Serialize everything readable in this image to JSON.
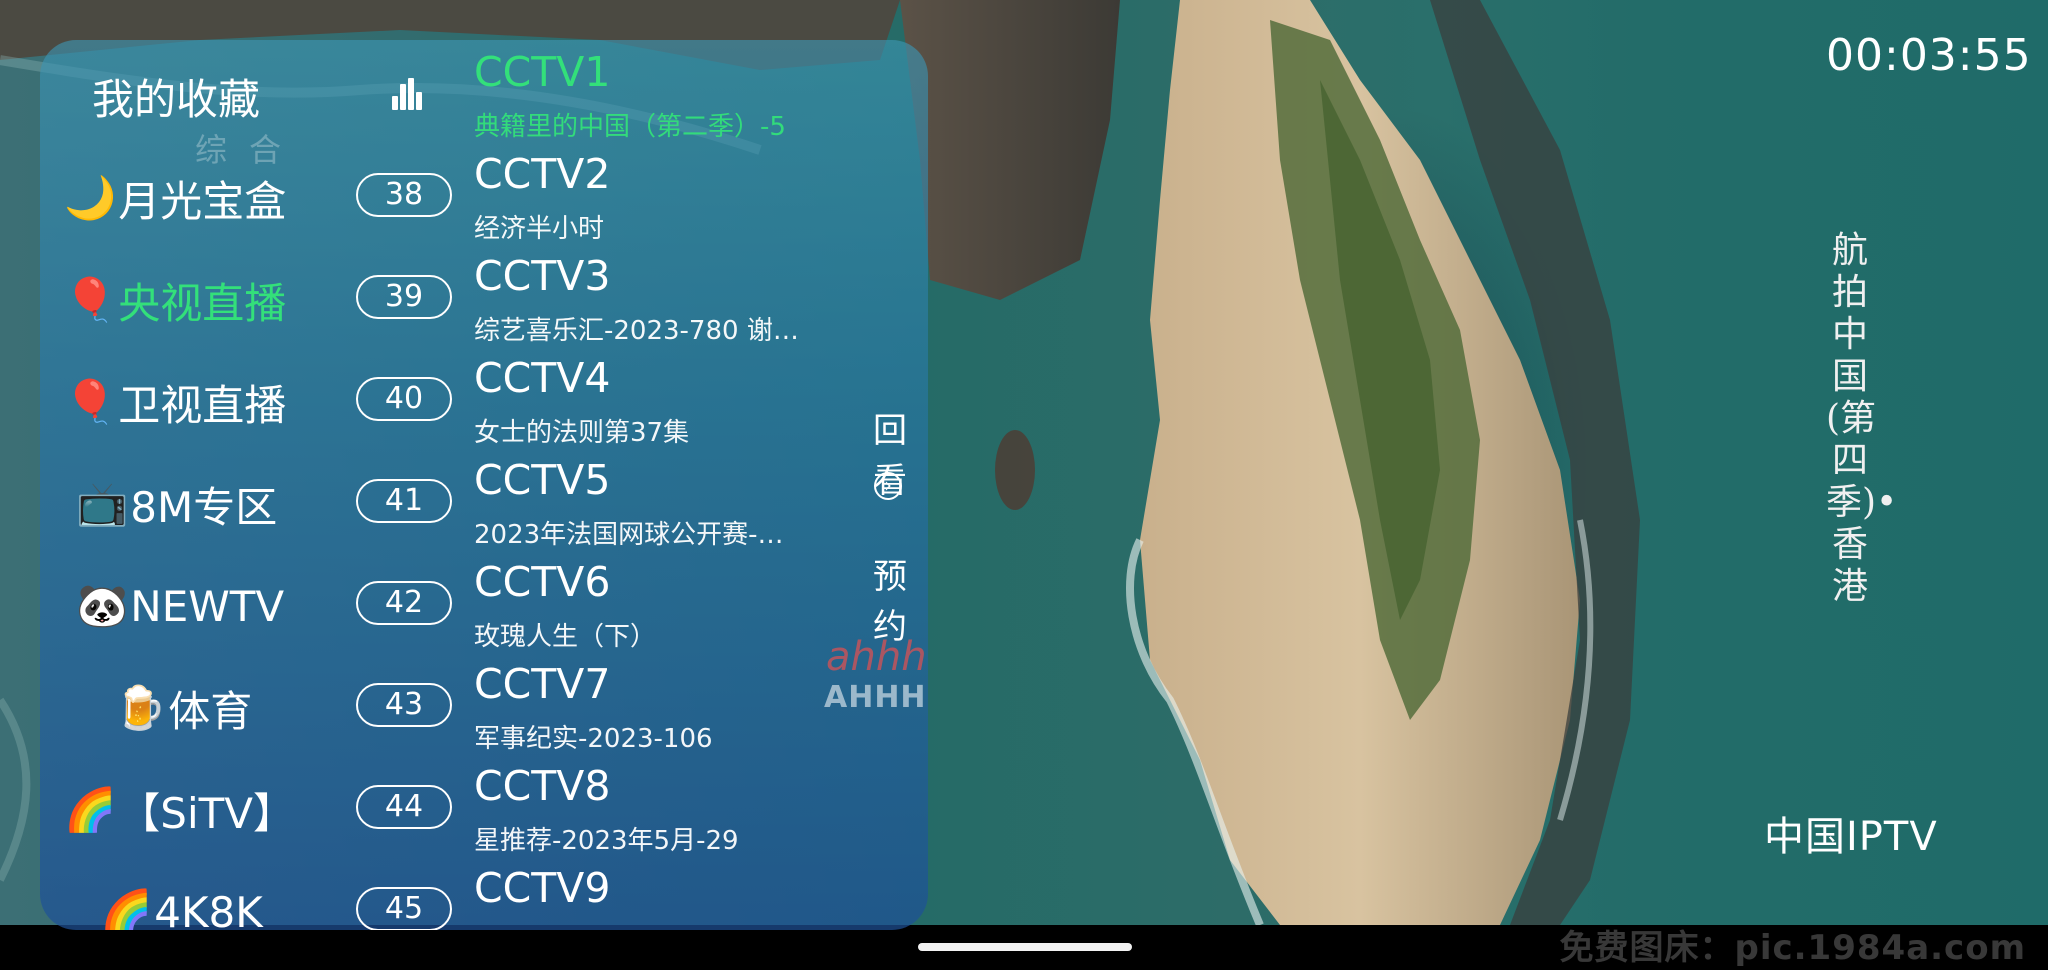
{
  "player": {
    "clock": "00:03:55",
    "program_title": "航拍中国(第四季)•香港",
    "channel_logo": "中国IPTV",
    "watermark": "免费图床：pic.1984a.com",
    "site_watermark": "AHHHHFS.COM",
    "site_watermark_logo": "ahhhhfs"
  },
  "categories": {
    "header": "我的收藏",
    "header_faint": "综合",
    "header_icon": "equalizer-icon",
    "items": [
      {
        "emoji": "🌙",
        "label": "月光宝盒",
        "active": false
      },
      {
        "emoji": "🎈",
        "label": "央视直播",
        "active": true
      },
      {
        "emoji": "🎈",
        "label": "卫视直播",
        "active": false
      },
      {
        "emoji": "📺",
        "label": "8M专区",
        "active": false
      },
      {
        "emoji": "🐼",
        "label": "NEWTV",
        "active": false
      },
      {
        "emoji": "🍺",
        "label": "体育",
        "active": false
      },
      {
        "emoji": "🌈",
        "label": "【SiTV】",
        "active": false
      },
      {
        "emoji": "🌈",
        "label": "4K8K",
        "active": false
      }
    ]
  },
  "channels": [
    {
      "number": "",
      "name": "CCTV1",
      "program": "典籍里的中国（第二季）-5",
      "active": true
    },
    {
      "number": "38",
      "name": "CCTV2",
      "program": "经济半小时",
      "active": false
    },
    {
      "number": "39",
      "name": "CCTV3",
      "program": "综艺喜乐汇-2023-780 谢…",
      "active": false
    },
    {
      "number": "40",
      "name": "CCTV4",
      "program": "女士的法则第37集",
      "active": false
    },
    {
      "number": "41",
      "name": "CCTV5",
      "program": "2023年法国网球公开赛-…",
      "active": false
    },
    {
      "number": "42",
      "name": "CCTV6",
      "program": "玫瑰人生（下）",
      "active": false
    },
    {
      "number": "43",
      "name": "CCTV7",
      "program": "军事纪实-2023-106",
      "active": false
    },
    {
      "number": "44",
      "name": "CCTV8",
      "program": "星推荐-2023年5月-29",
      "active": false
    },
    {
      "number": "45",
      "name": "CCTV9",
      "program": "",
      "active": false
    }
  ],
  "side_actions": {
    "replay": "回看",
    "reserve": "预约",
    "arrow_icon": "chevron-right-circle-icon"
  }
}
